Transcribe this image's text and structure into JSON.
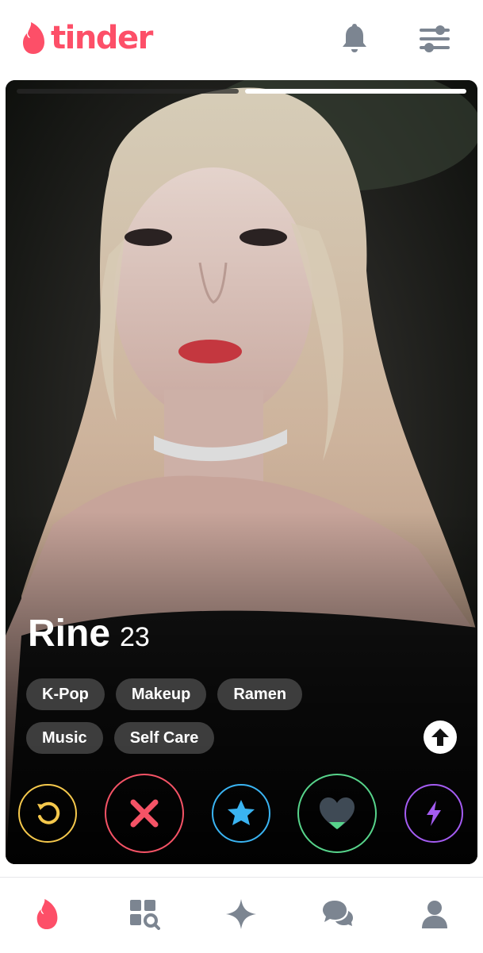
{
  "app": {
    "logo_text": "tinder",
    "brand_color": "#fd4f68"
  },
  "header": {
    "icons": [
      "bell-icon",
      "filter-sliders-icon"
    ]
  },
  "card": {
    "progress": {
      "total": 2,
      "active_index": 1
    },
    "profile": {
      "name": "Rine",
      "age": "23"
    },
    "interests": [
      "K-Pop",
      "Makeup",
      "Ramen",
      "Music",
      "Self Care"
    ],
    "info_icon": "arrow-up-icon"
  },
  "actions": [
    {
      "name": "rewind",
      "icon": "rewind-icon",
      "color": "#f5c84c"
    },
    {
      "name": "nope",
      "icon": "close-icon",
      "color": "#f55366"
    },
    {
      "name": "super-like",
      "icon": "star-icon",
      "color": "#3ab4f2"
    },
    {
      "name": "like",
      "icon": "heart-icon",
      "color": "#57d48b"
    },
    {
      "name": "boost",
      "icon": "lightning-icon",
      "color": "#a45cf2"
    }
  ],
  "bottom_nav": {
    "items": [
      "tinder-flame-icon",
      "explore-icon",
      "sparkle-icon",
      "chat-icon",
      "profile-icon"
    ],
    "active_color": "#fd4f68",
    "inactive_color": "#7c8591"
  }
}
